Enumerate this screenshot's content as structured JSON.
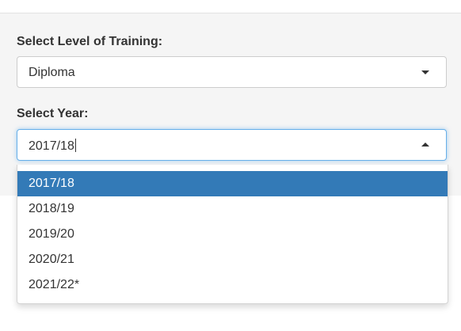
{
  "level_field": {
    "label": "Select Level of Training:",
    "selected": "Diploma"
  },
  "year_field": {
    "label": "Select Year:",
    "selected": "2017/18",
    "options": [
      "2017/18",
      "2018/19",
      "2019/20",
      "2020/21",
      "2021/22*"
    ],
    "highlighted": "2017/18"
  },
  "colors": {
    "highlight": "#337ab7",
    "panel_bg": "#f5f5f5",
    "focus_border": "#66afe9"
  },
  "icons": {
    "collapsed": "caret-down-icon",
    "expanded": "caret-up-icon"
  }
}
